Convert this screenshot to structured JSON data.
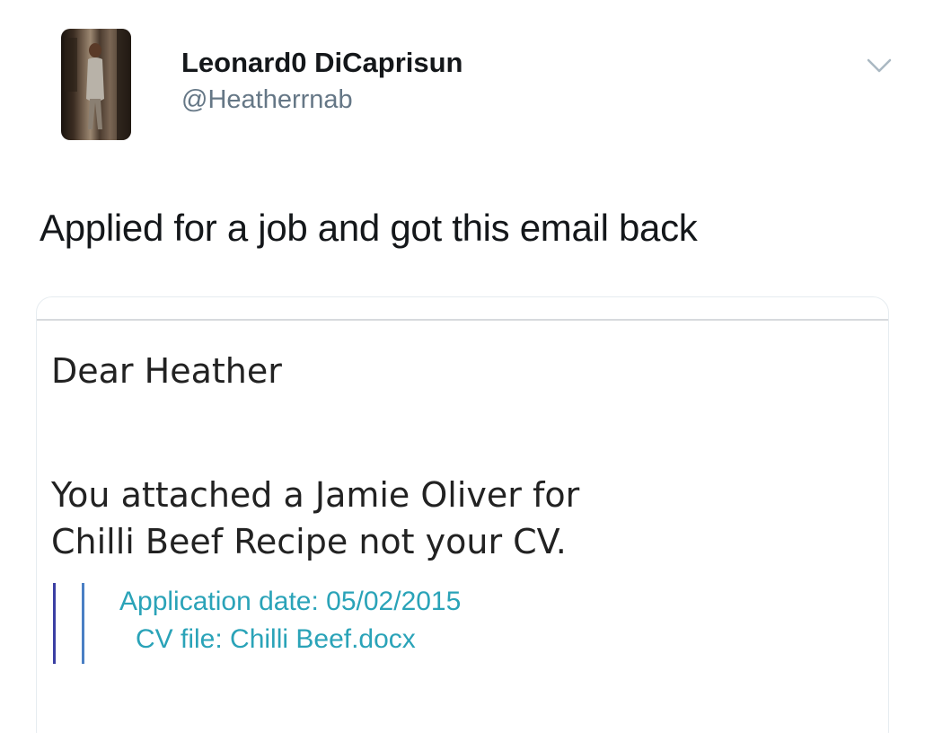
{
  "tweet": {
    "display_name": "Leonard0 DiCaprisun",
    "handle": "@Heatherrnab",
    "text": "Applied for a job and got this email back"
  },
  "email": {
    "greeting": "Dear Heather",
    "body_line_1": "You attached a Jamie Oliver for",
    "body_line_2": "Chilli Beef Recipe not your CV.",
    "quoted": {
      "application_date": "Application date: 05/02/2015",
      "cv_file": "CV file: Chilli Beef.docx"
    }
  },
  "icons": {
    "menu": "chevron-down-icon",
    "avatar": "profile-photo"
  },
  "colors": {
    "name": "#14171a",
    "handle": "#657786",
    "quoted_text": "#2aa3b8",
    "quote_bar_1": "#3b3fa3",
    "quote_bar_2": "#4a7fc4"
  }
}
